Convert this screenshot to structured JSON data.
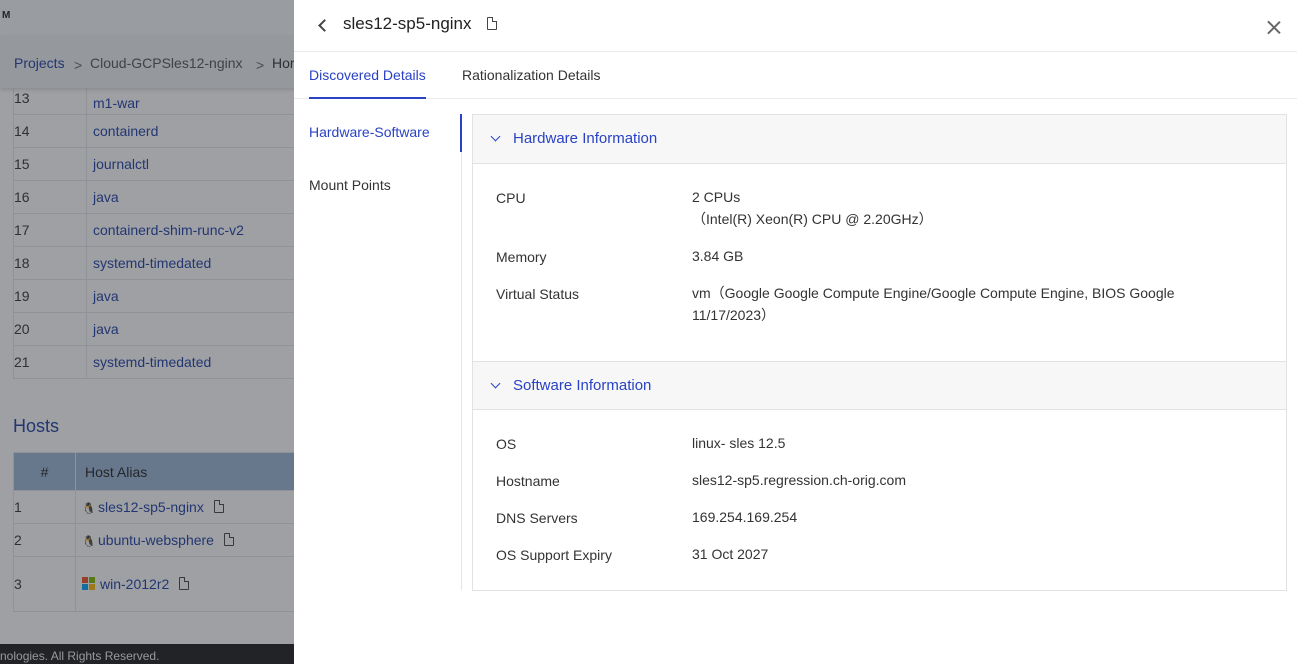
{
  "background": {
    "app_logo": "M",
    "breadcrumb": {
      "projects": "Projects",
      "sep": ">",
      "project": "Cloud-GCPSles12-nginx",
      "current": "Hor"
    },
    "processes": [
      {
        "num": "13",
        "name": "m1-war"
      },
      {
        "num": "14",
        "name": "containerd"
      },
      {
        "num": "15",
        "name": "journalctl"
      },
      {
        "num": "16",
        "name": "java"
      },
      {
        "num": "17",
        "name": "containerd-shim-runc-v2"
      },
      {
        "num": "18",
        "name": "systemd-timedated"
      },
      {
        "num": "19",
        "name": "java"
      },
      {
        "num": "20",
        "name": "java"
      },
      {
        "num": "21",
        "name": "systemd-timedated"
      }
    ],
    "hosts_title": "Hosts",
    "hosts_headers": {
      "num": "#",
      "alias": "Host Alias"
    },
    "hosts": [
      {
        "num": "1",
        "alias": "sles12-sp5-nginx",
        "os": "linux"
      },
      {
        "num": "2",
        "alias": "ubuntu-websphere",
        "os": "linux"
      },
      {
        "num": "3",
        "alias": "win-2012r2",
        "os": "windows"
      }
    ],
    "footer": "nologies. All Rights Reserved."
  },
  "drawer": {
    "title": "sles12-sp5-nginx",
    "tabs": {
      "discovered": "Discovered Details",
      "rationalization": "Rationalization Details"
    },
    "side_nav": {
      "hardware_software": "Hardware-Software",
      "mount_points": "Mount Points"
    },
    "hardware": {
      "title": "Hardware Information",
      "cpu_label": "CPU",
      "cpu_value": "2 CPUs",
      "cpu_detail": "（Intel(R) Xeon(R) CPU @ 2.20GHz）",
      "memory_label": "Memory",
      "memory_value": "3.84 GB",
      "virtual_label": "Virtual Status",
      "virtual_value_1": "vm（Google Google Compute Engine/Google Compute Engine, BIOS Google",
      "virtual_value_2": "11/17/2023）"
    },
    "software": {
      "title": "Software Information",
      "os_label": "OS",
      "os_value": "linux- sles 12.5",
      "hostname_label": "Hostname",
      "hostname_value": "sles12-sp5.regression.ch-orig.com",
      "dns_label": "DNS Servers",
      "dns_value": "169.254.169.254",
      "expiry_label": "OS Support Expiry",
      "expiry_value": "31 Oct 2027"
    }
  }
}
